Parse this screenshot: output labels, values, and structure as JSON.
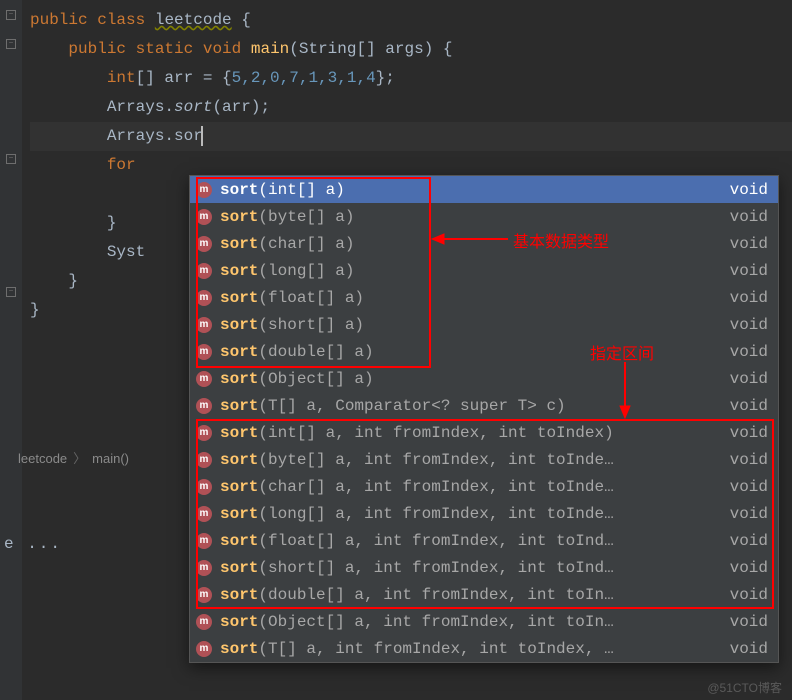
{
  "code": {
    "line1_public": "public",
    "line1_class": "class",
    "line1_name": "leetcode",
    "line1_brace": "{",
    "line2_public": "public",
    "line2_static": "static",
    "line2_void": "void",
    "line2_main": "main",
    "line2_sig": "(String[] args) {",
    "line3_int": "int",
    "line3_arr": "[] arr = {",
    "line3_nums": "5,2,0,7,1,3,1,4",
    "line3_end": "};",
    "line4_arrays": "Arrays",
    "line4_dot": ".",
    "line4_sort": "sort",
    "line4_args": "(arr);",
    "line5_arrays": "Arrays",
    "line5_dot": ".",
    "line5_partial": "sor",
    "line6_for": "for",
    "line7_brace": "}",
    "line8_sys": "Syst",
    "line9_brace": "}",
    "line10_brace": "}"
  },
  "popup": {
    "items": [
      {
        "name": "sort",
        "sig": "(int[] a)",
        "ret": "void",
        "sel": true
      },
      {
        "name": "sort",
        "sig": "(byte[] a)",
        "ret": "void"
      },
      {
        "name": "sort",
        "sig": "(char[] a)",
        "ret": "void"
      },
      {
        "name": "sort",
        "sig": "(long[] a)",
        "ret": "void"
      },
      {
        "name": "sort",
        "sig": "(float[] a)",
        "ret": "void"
      },
      {
        "name": "sort",
        "sig": "(short[] a)",
        "ret": "void"
      },
      {
        "name": "sort",
        "sig": "(double[] a)",
        "ret": "void"
      },
      {
        "name": "sort",
        "sig": "(Object[] a)",
        "ret": "void"
      },
      {
        "name": "sort",
        "sig": "(T[] a, Comparator<? super T> c)",
        "ret": "void"
      },
      {
        "name": "sort",
        "sig": "(int[] a, int fromIndex, int toIndex)",
        "ret": "void"
      },
      {
        "name": "sort",
        "sig": "(byte[] a, int fromIndex, int toInde…",
        "ret": "void"
      },
      {
        "name": "sort",
        "sig": "(char[] a, int fromIndex, int toInde…",
        "ret": "void"
      },
      {
        "name": "sort",
        "sig": "(long[] a, int fromIndex, int toInde…",
        "ret": "void"
      },
      {
        "name": "sort",
        "sig": "(float[] a, int fromIndex, int toInd…",
        "ret": "void"
      },
      {
        "name": "sort",
        "sig": "(short[] a, int fromIndex, int toInd…",
        "ret": "void"
      },
      {
        "name": "sort",
        "sig": "(double[] a, int fromIndex, int toIn…",
        "ret": "void"
      },
      {
        "name": "sort",
        "sig": "(Object[] a, int fromIndex, int toIn…",
        "ret": "void"
      },
      {
        "name": "sort",
        "sig": "(T[] a, int fromIndex, int toIndex, …",
        "ret": "void"
      }
    ]
  },
  "annotations": {
    "label1": "基本数据类型",
    "label2": "指定区间"
  },
  "breadcrumb": {
    "class": "leetcode",
    "method": "main()"
  },
  "ellipsis": "e ...",
  "watermark": "@51CTO博客"
}
